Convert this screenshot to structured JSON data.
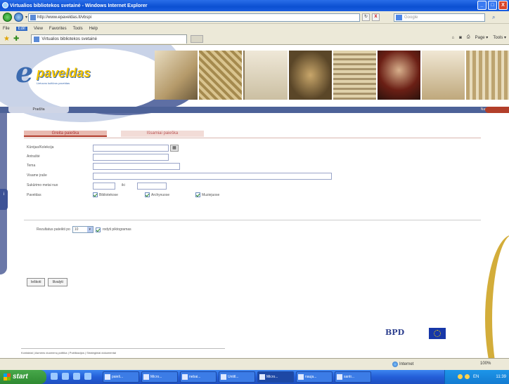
{
  "window": {
    "title": "Virtualios bibliotekos svetainė - Windows Internet Explorer",
    "buttons": [
      "_",
      "□",
      "X"
    ]
  },
  "address_bar": {
    "url": "http://www.epaveldas.lt/vbspi",
    "search_placeholder": "Google",
    "refresh": "↻",
    "stop": "X"
  },
  "menu": {
    "items": [
      "File",
      "Edit",
      "View",
      "Favorites",
      "Tools",
      "Help"
    ]
  },
  "tabs_bar": {
    "tab_title": "Virtualios bibliotekos svetainė",
    "commands": [
      "Page ▾",
      "Tools ▾"
    ]
  },
  "site": {
    "logo_text": "paveldas",
    "logo_subtitle": "Lietuvos kultūros paveldas",
    "home_tab": "Pradžia",
    "top_links": "Naujienos",
    "side_tab": "i"
  },
  "search": {
    "tabs": [
      "Greita paieška",
      "Išsamiai paieška"
    ],
    "fields": [
      {
        "label": "Kūrėjas/Kolekcija"
      },
      {
        "label": "Antraštė"
      },
      {
        "label": "Tema"
      },
      {
        "label": "Visame įraše"
      },
      {
        "label": "Sukūrimo metai nuo",
        "iki_label": "iki"
      },
      {
        "label": "Paveldas"
      }
    ],
    "institutions": [
      "Bibliotekose",
      "Archyvuose",
      "Muziejuose"
    ],
    "results_label": "Rezultatus pateikti po",
    "results_value": "10",
    "thumbnails_label": "rodyti piktogramas",
    "submit_label": "Ieškoti",
    "clear_label": "Išvalyti"
  },
  "footer": {
    "links": "Kontaktai | Asmens duomenų politika | Publikacijos | Strateginiai dokumentai",
    "partner_logo": "BPD"
  },
  "status_bar": {
    "zone": "Internet",
    "zoom": "100%"
  },
  "taskbar": {
    "start": "start",
    "tasks": [
      "paieš...",
      "Micro...",
      "nebai...",
      "Untitl...",
      "Micro...",
      "nauja...",
      "santr..."
    ],
    "lang": "EN",
    "clock": "11:39"
  },
  "colors": {
    "brand_blue": "#3c6bb0",
    "brand_gold": "#f4c400",
    "tab_accent": "#b13a2a"
  }
}
